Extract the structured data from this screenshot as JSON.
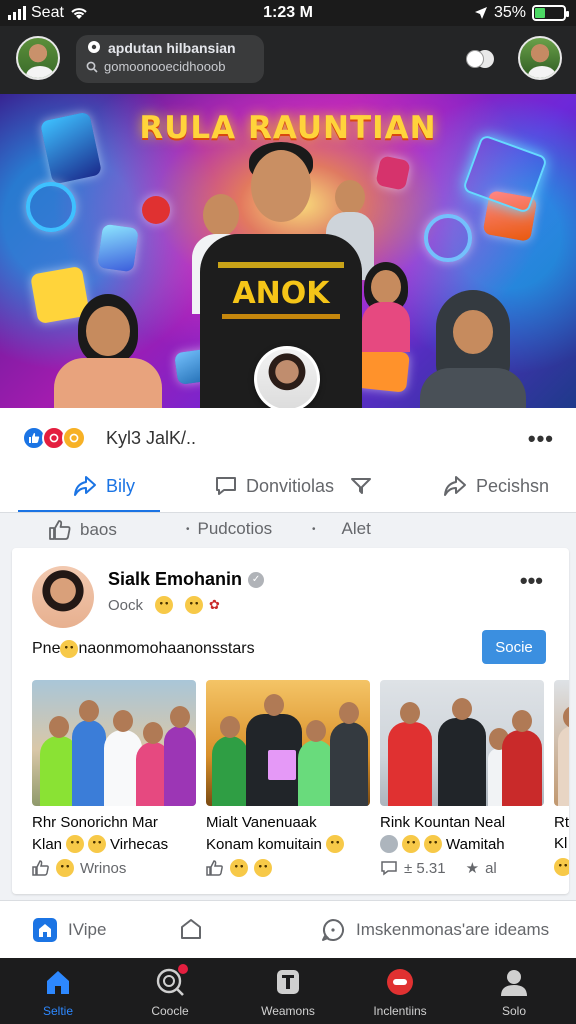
{
  "status_bar": {
    "carrier": "Seat",
    "time": "1:23 M",
    "battery": "35%",
    "battery_level": 0.35
  },
  "header": {
    "search_title": "apdutan hilbansian",
    "search_subtitle": "gomoonooecidhooob"
  },
  "cover": {
    "title": "RULA RAUNTIAN",
    "shirt_text": "ANOK"
  },
  "reactions": {
    "names": "Kyl3 JalK/.."
  },
  "actions": [
    {
      "label": "Bily",
      "icon": "share-icon"
    },
    {
      "label": "Donvitiolas",
      "icon": "comment-icon"
    },
    {
      "label": "Pecishsn",
      "icon": "share-arrow-icon"
    }
  ],
  "subtabs": [
    {
      "label": "baos",
      "icon": "like-icon"
    },
    {
      "label": "Pudcotios"
    },
    {
      "label": "Alet"
    }
  ],
  "post": {
    "author": "Sialk Emohanin",
    "meta": "Oock",
    "text_prefix": "Pne",
    "text_suffix": "naonmomohaanonsstars",
    "button": "Socie",
    "photos": [
      {
        "cap1": "Rhr Sonorichn Mar",
        "cap2_a": "Klan",
        "cap2_b": "Virhecas",
        "stats": "Wrinos"
      },
      {
        "cap1": "Mialt Vanenuaak",
        "cap2_a": "Konam komuitain",
        "cap2_b": "",
        "stats": ""
      },
      {
        "cap1": "Rink Kountan Neal",
        "cap2_a": "",
        "cap2_b": "Wamitah",
        "stats_a": "± 5.31",
        "stats_b": "al"
      },
      {
        "cap1": "Rt",
        "cap2_a": "Kl",
        "cap2_b": "",
        "stats": ""
      }
    ]
  },
  "card_foot": [
    {
      "label": "IVipe",
      "icon": "home-square-icon"
    },
    {
      "label": "",
      "icon": "chat-bubble-icon"
    },
    {
      "label": "Imskenmonas'are ideams",
      "icon": "message-circle-icon"
    }
  ],
  "bottom_nav": [
    {
      "label": "Seltie",
      "icon": "home-icon",
      "active": true
    },
    {
      "label": "Coocle",
      "icon": "search-icon"
    },
    {
      "label": "Weamons",
      "icon": "trash-icon"
    },
    {
      "label": "Inclentiins",
      "icon": "chat-icon"
    },
    {
      "label": "Solo",
      "icon": "profile-icon"
    }
  ],
  "colors": {
    "accent": "#1b74e4",
    "header_bg": "#242526",
    "nav_bg": "#1c1c1d",
    "button": "#3b8fe0"
  }
}
